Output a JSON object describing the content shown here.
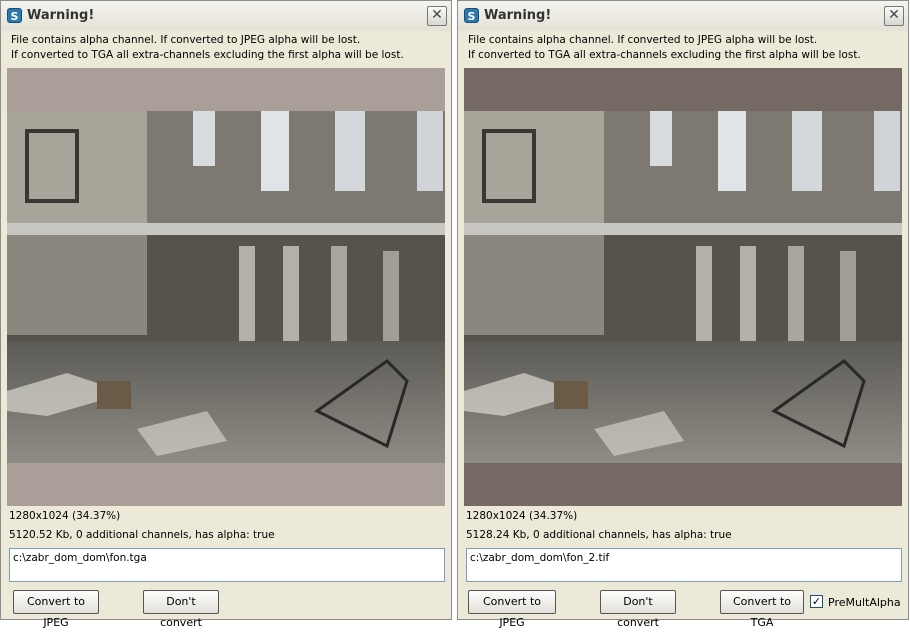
{
  "dialogs": [
    {
      "title": "Warning!",
      "message_line1": "File contains alpha channel. If converted to JPEG alpha will be lost.",
      "message_line2": "If converted to TGA all extra-channels excluding the first alpha will be lost.",
      "preview_bg": "#aa9f98",
      "resolution": "1280x1024 (34.37%)",
      "details": "5120.52 Kb, 0 additional channels, has alpha: true",
      "path": "c:\\zabr_dom_dom\\fon.tga",
      "buttons": {
        "convert_jpeg": "Convert to JPEG",
        "dont_convert": "Don't convert"
      }
    },
    {
      "title": "Warning!",
      "message_line1": "File contains alpha channel. If converted to JPEG alpha will be lost.",
      "message_line2": "If converted to TGA all extra-channels excluding the first alpha will be lost.",
      "preview_bg": "#756a63",
      "resolution": "1280x1024 (34.37%)",
      "details": "5128.24 Kb, 0 additional channels, has alpha: true",
      "path": "c:\\zabr_dom_dom\\fon_2.tif",
      "buttons": {
        "convert_jpeg": "Convert to JPEG",
        "dont_convert": "Don't convert",
        "convert_tga": "Convert to TGA"
      },
      "premult": {
        "label": "PreMultAlpha",
        "checked": true
      }
    }
  ],
  "icons": {
    "app": "app-icon",
    "close": "close-icon",
    "check": "check-icon"
  }
}
